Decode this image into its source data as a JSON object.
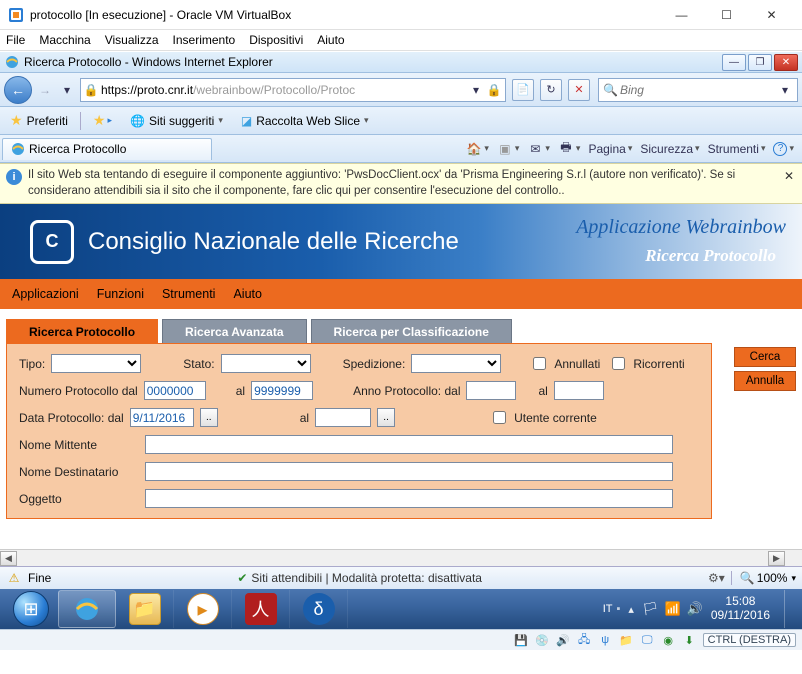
{
  "window": {
    "title": "protocollo [In esecuzione] - Oracle VM VirtualBox",
    "menu": [
      "File",
      "Macchina",
      "Visualizza",
      "Inserimento",
      "Dispositivi",
      "Aiuto"
    ]
  },
  "ie": {
    "title": "Ricerca Protocollo - Windows Internet Explorer",
    "url_secure": "https://",
    "url_host": "proto.cnr.it",
    "url_rest": "/webrainbow/Protocollo/Protoc",
    "search_placeholder": "Bing",
    "favorites_label": "Preferiti",
    "suggested_label": "Siti suggeriti",
    "web_slice_label": "Raccolta Web Slice",
    "tab_label": "Ricerca Protocollo",
    "tools": {
      "page": "Pagina",
      "security": "Sicurezza",
      "tools": "Strumenti"
    },
    "infobar": "Il sito Web sta tentando di eseguire il componente aggiuntivo: 'PwsDocClient.ocx' da 'Prisma Engineering S.r.l (autore non verificato)'. Se si considerano attendibili sia il sito che il componente, fare clic qui per consentire l'esecuzione del controllo..",
    "status_left": "Fine",
    "status_mid": "Siti attendibili | Modalità protetta: disattivata",
    "zoom": "100%"
  },
  "app": {
    "org": "Consiglio Nazionale delle Ricerche",
    "app_title": "Applicazione Webrainbow",
    "app_sub": "Ricerca Protocollo",
    "menu": [
      "Applicazioni",
      "Funzioni",
      "Strumenti",
      "Aiuto"
    ],
    "tabs": [
      "Ricerca Protocollo",
      "Ricerca Avanzata",
      "Ricerca per Classificazione"
    ],
    "actions": {
      "search": "Cerca",
      "cancel": "Annulla"
    },
    "form": {
      "tipo": "Tipo:",
      "stato": "Stato:",
      "spedizione": "Spedizione:",
      "annullati": "Annullati",
      "ricorrenti": "Ricorrenti",
      "num_dal": "Numero Protocollo dal",
      "num_dal_val": "0000000",
      "al": "al",
      "num_al_val": "9999999",
      "anno_dal": "Anno Protocollo:  dal",
      "data_dal": "Data Protocollo: dal",
      "data_dal_val": "9/11/2016",
      "utente_corrente": "Utente corrente",
      "nome_mittente": "Nome Mittente",
      "nome_dest": "Nome Destinatario",
      "oggetto": "Oggetto"
    }
  },
  "taskbar": {
    "lang": "IT",
    "time": "15:08",
    "date": "09/11/2016"
  },
  "vbox": {
    "ctrl": "CTRL (DESTRA)"
  }
}
